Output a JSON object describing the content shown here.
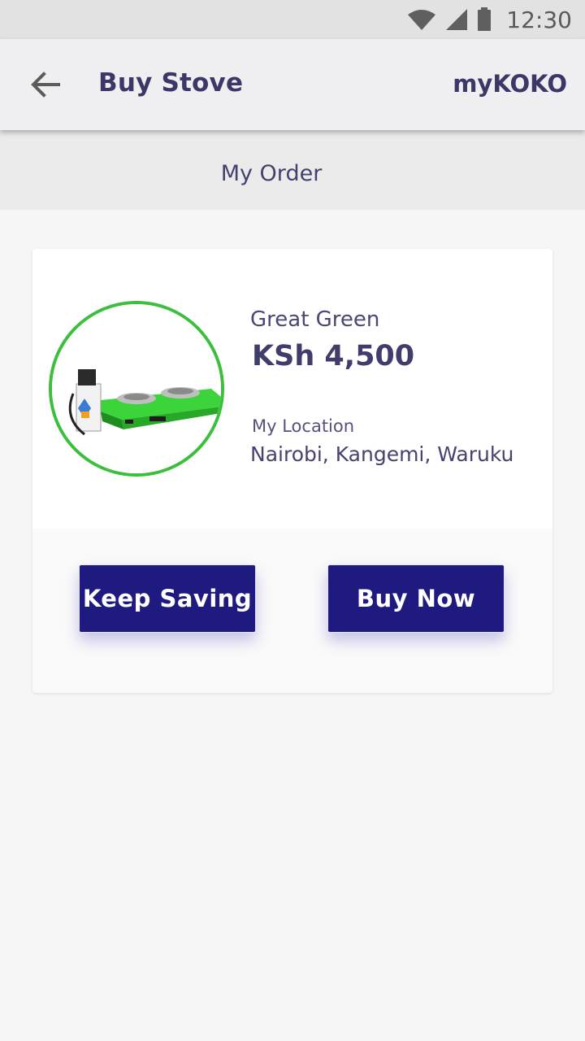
{
  "status_bar": {
    "time": "12:30",
    "icons": [
      "wifi-icon",
      "signal-icon",
      "battery-icon"
    ]
  },
  "app_bar": {
    "back_icon": "arrow-left-icon",
    "title": "Buy Stove",
    "brand": "myKOKO"
  },
  "section": {
    "title": "My Order"
  },
  "order": {
    "product_name": "Great Green",
    "price": "KSh 4,500",
    "location_label": "My Location",
    "location": "Nairobi, Kangemi, Waruku",
    "product_image": "stove-product-image"
  },
  "actions": {
    "keep_saving": "Keep Saving",
    "buy_now": "Buy Now"
  },
  "colors": {
    "primary": "#1f1a80",
    "accent_ring": "#3cbf3c",
    "text": "#3d3b66",
    "app_bar_bg": "#efeff1"
  }
}
